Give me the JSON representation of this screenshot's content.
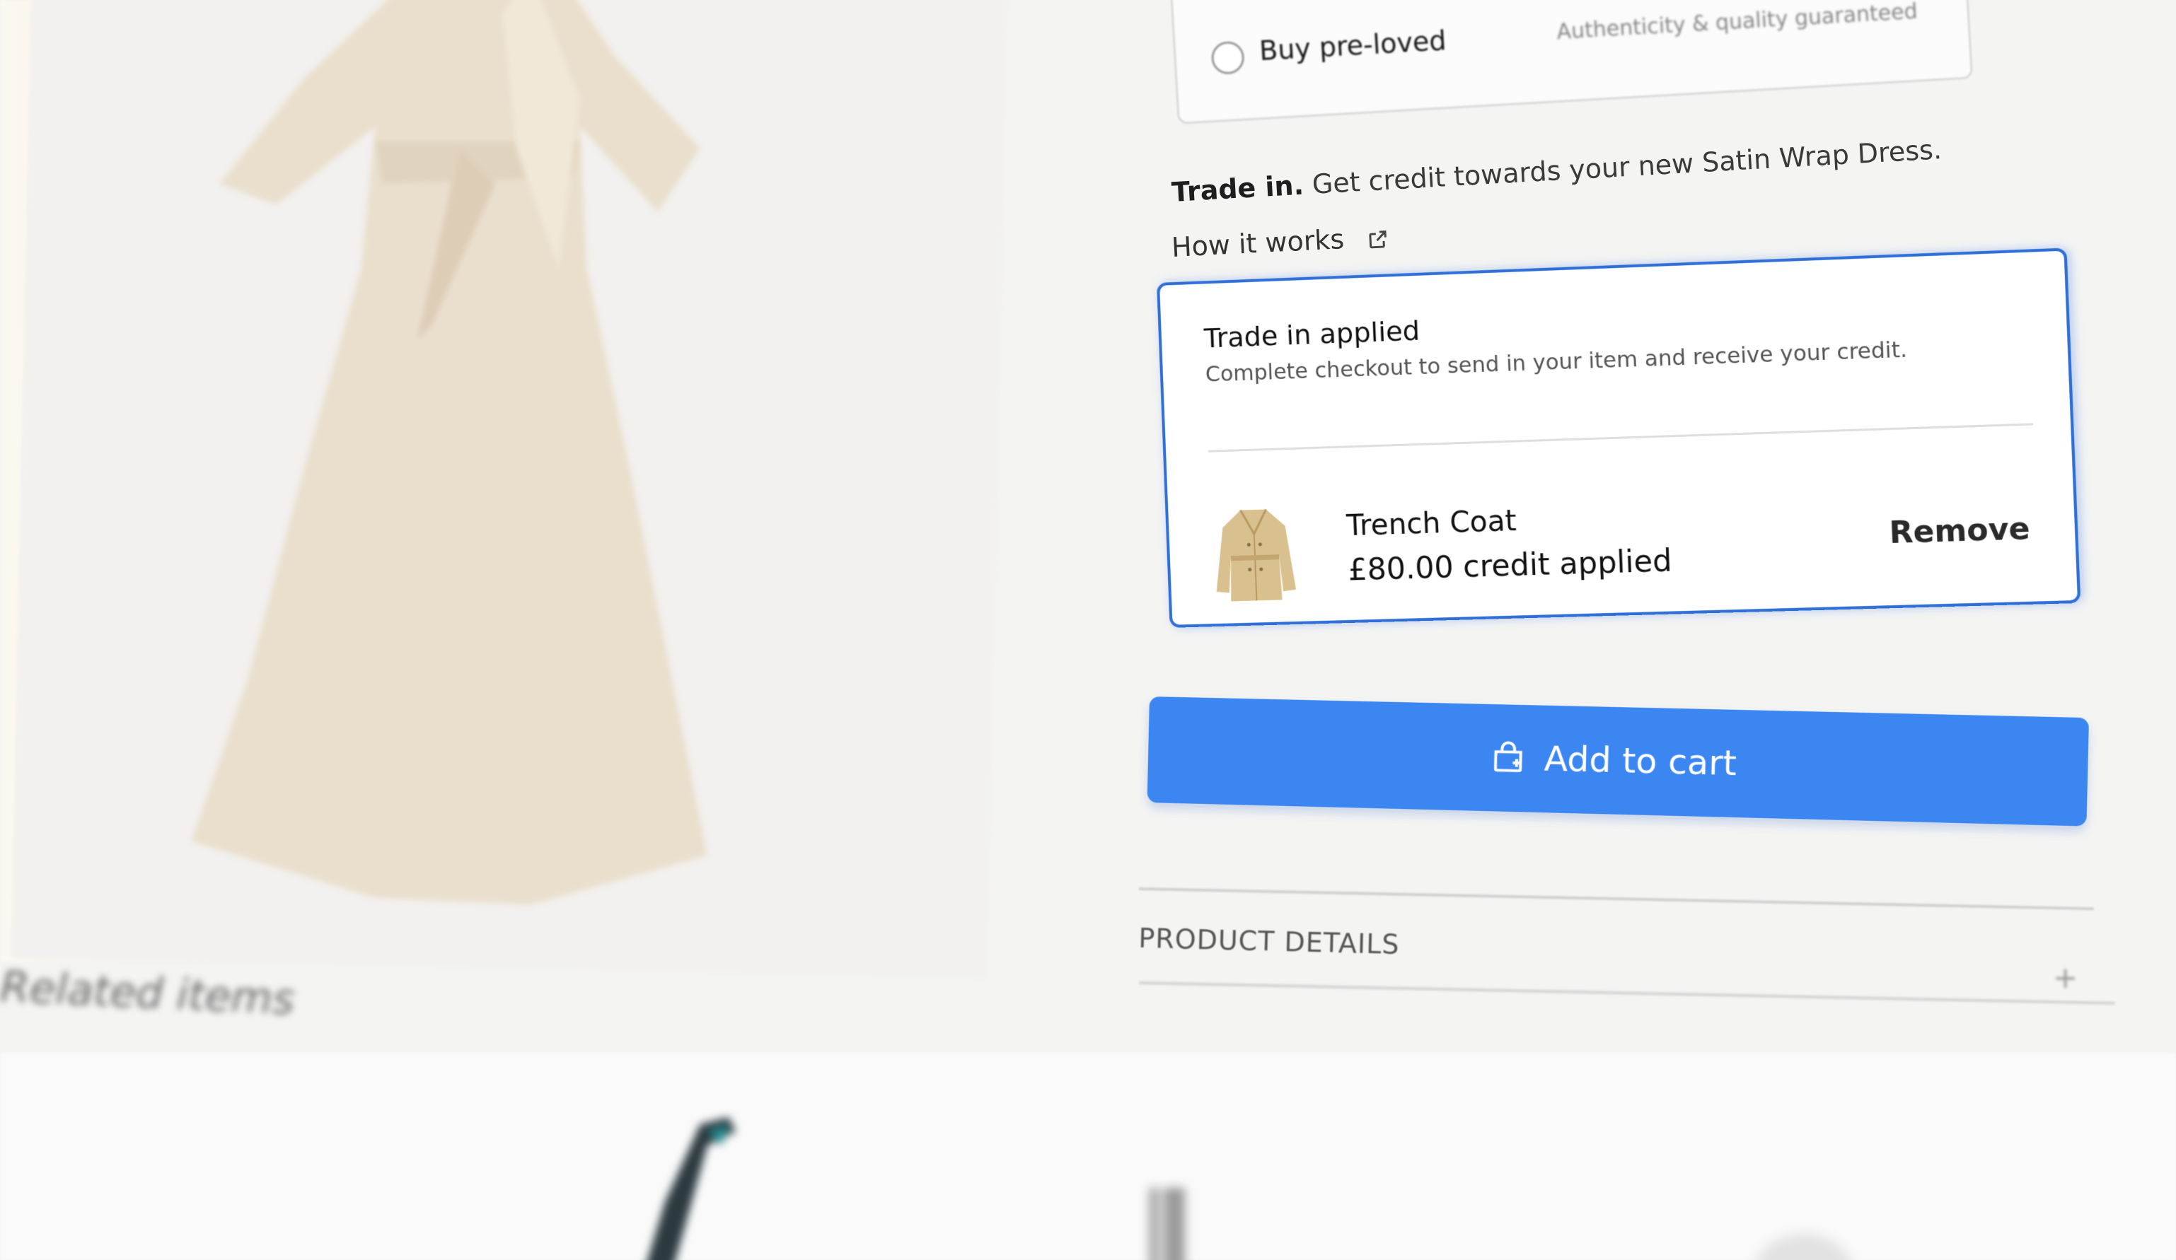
{
  "purchase_options": {
    "preloved_label": "Buy pre-loved",
    "preloved_note": "Authenticity & quality guaranteed",
    "preloved_price": "£..."
  },
  "trade_in": {
    "heading_bold": "Trade in.",
    "heading_rest": "Get credit towards your new Satin Wrap Dress.",
    "how_it_works": "How it works",
    "card": {
      "title": "Trade in applied",
      "subtitle": "Complete checkout to send in your item and receive your credit.",
      "item_name": "Trench Coat",
      "credit_text": "£80.00 credit applied",
      "remove_label": "Remove"
    }
  },
  "cart": {
    "add_to_cart_label": "Add to cart"
  },
  "details": {
    "product_details_label": "PRODUCT DETAILS",
    "expand_symbol": "+"
  },
  "related": {
    "title": "Related items"
  },
  "colors": {
    "accent_blue": "#3b86f0",
    "card_border": "#2f6fd6"
  }
}
